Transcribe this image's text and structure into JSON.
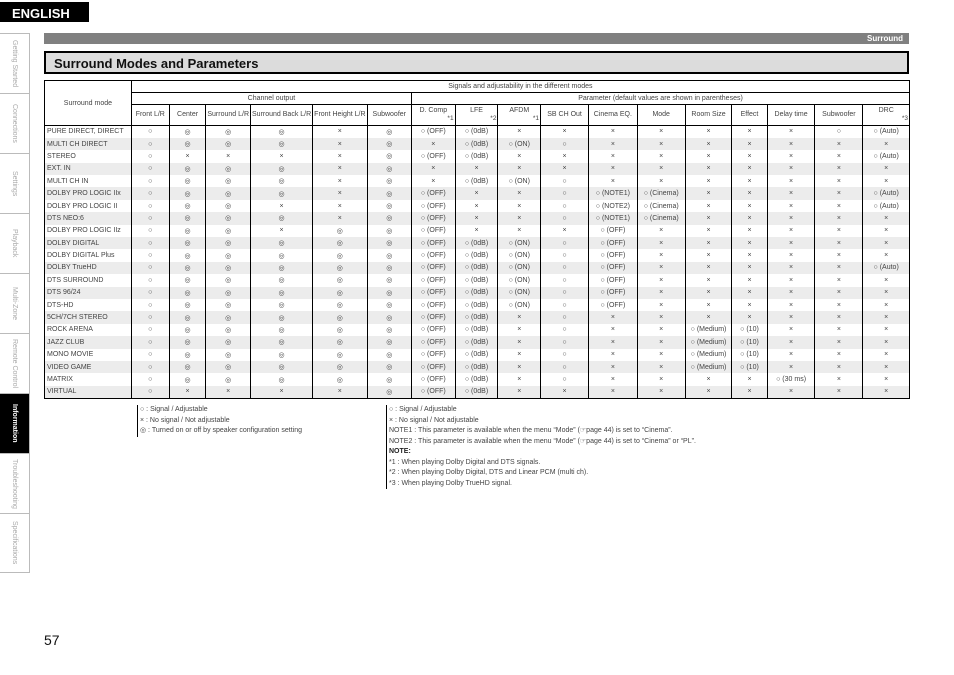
{
  "language": "ENGLISH",
  "side_nav": [
    {
      "label": "Getting Started",
      "active": false
    },
    {
      "label": "Connections",
      "active": false
    },
    {
      "label": "Settings",
      "active": false
    },
    {
      "label": "Playback",
      "active": false
    },
    {
      "label": "Multi-Zone",
      "active": false
    },
    {
      "label": "Remote Control",
      "active": false
    },
    {
      "label": "Information",
      "active": true
    },
    {
      "label": "Troubleshooting",
      "active": false
    },
    {
      "label": "Specifications",
      "active": false
    }
  ],
  "section_bar": "Surround",
  "page_title": "Surround Modes and Parameters",
  "table": {
    "mode_header": "Surround mode",
    "group_header": "Signals and adjustability in the different modes",
    "channel_header": "Channel output",
    "param_header": "Parameter (default values are shown in parentheses)",
    "columns": [
      {
        "label": "Front L/R",
        "note": ""
      },
      {
        "label": "Center",
        "note": ""
      },
      {
        "label": "Surround L/R",
        "note": ""
      },
      {
        "label": "Surround Back L/R",
        "note": ""
      },
      {
        "label": "Front Height L/R",
        "note": ""
      },
      {
        "label": "Subwoofer",
        "note": ""
      },
      {
        "label": "D. Comp",
        "note": "*1"
      },
      {
        "label": "LFE",
        "note": "*2"
      },
      {
        "label": "AFDM",
        "note": "*1"
      },
      {
        "label": "SB CH Out",
        "note": ""
      },
      {
        "label": "Cinema EQ.",
        "note": ""
      },
      {
        "label": "Mode",
        "note": ""
      },
      {
        "label": "Room Size",
        "note": ""
      },
      {
        "label": "Effect",
        "note": ""
      },
      {
        "label": "Delay time",
        "note": ""
      },
      {
        "label": "Subwoofer",
        "note": ""
      },
      {
        "label": "DRC",
        "note": "*3"
      }
    ],
    "rows": [
      {
        "mode": "PURE DIRECT, DIRECT",
        "cells": [
          "○",
          "◎",
          "◎",
          "◎",
          "×",
          "◎",
          "○ (OFF)",
          "○ (0dB)",
          "×",
          "×",
          "×",
          "×",
          "×",
          "×",
          "×",
          "○",
          "○ (Auto)"
        ]
      },
      {
        "mode": "MULTI CH DIRECT",
        "cells": [
          "○",
          "◎",
          "◎",
          "◎",
          "×",
          "◎",
          "×",
          "○ (0dB)",
          "○ (ON)",
          "○",
          "×",
          "×",
          "×",
          "×",
          "×",
          "×",
          "×"
        ]
      },
      {
        "mode": "STEREO",
        "cells": [
          "○",
          "×",
          "×",
          "×",
          "×",
          "◎",
          "○ (OFF)",
          "○ (0dB)",
          "×",
          "×",
          "×",
          "×",
          "×",
          "×",
          "×",
          "×",
          "○ (Auto)"
        ]
      },
      {
        "mode": "EXT. IN",
        "cells": [
          "○",
          "◎",
          "◎",
          "◎",
          "×",
          "◎",
          "×",
          "×",
          "×",
          "×",
          "×",
          "×",
          "×",
          "×",
          "×",
          "×",
          "×"
        ]
      },
      {
        "mode": "MULTI CH IN",
        "cells": [
          "○",
          "◎",
          "◎",
          "◎",
          "×",
          "◎",
          "×",
          "○ (0dB)",
          "○ (ON)",
          "○",
          "×",
          "×",
          "×",
          "×",
          "×",
          "×",
          "×"
        ]
      },
      {
        "mode": "DOLBY PRO LOGIC IIx",
        "cells": [
          "○",
          "◎",
          "◎",
          "◎",
          "×",
          "◎",
          "○ (OFF)",
          "×",
          "×",
          "○",
          "○ (NOTE1)",
          "○ (Cinema)",
          "×",
          "×",
          "×",
          "×",
          "○ (Auto)"
        ]
      },
      {
        "mode": "DOLBY PRO LOGIC II",
        "cells": [
          "○",
          "◎",
          "◎",
          "×",
          "×",
          "◎",
          "○ (OFF)",
          "×",
          "×",
          "○",
          "○ (NOTE2)",
          "○ (Cinema)",
          "×",
          "×",
          "×",
          "×",
          "○ (Auto)"
        ]
      },
      {
        "mode": "DTS NEO:6",
        "cells": [
          "○",
          "◎",
          "◎",
          "◎",
          "×",
          "◎",
          "○ (OFF)",
          "×",
          "×",
          "○",
          "○ (NOTE1)",
          "○ (Cinema)",
          "×",
          "×",
          "×",
          "×",
          "×"
        ]
      },
      {
        "mode": "DOLBY PRO LOGIC IIz",
        "cells": [
          "○",
          "◎",
          "◎",
          "×",
          "◎",
          "◎",
          "○ (OFF)",
          "×",
          "×",
          "×",
          "○ (OFF)",
          "×",
          "×",
          "×",
          "×",
          "×",
          "×"
        ]
      },
      {
        "mode": "DOLBY DIGITAL",
        "cells": [
          "○",
          "◎",
          "◎",
          "◎",
          "◎",
          "◎",
          "○ (OFF)",
          "○ (0dB)",
          "○ (ON)",
          "○",
          "○ (OFF)",
          "×",
          "×",
          "×",
          "×",
          "×",
          "×"
        ]
      },
      {
        "mode": "DOLBY DIGITAL Plus",
        "cells": [
          "○",
          "◎",
          "◎",
          "◎",
          "◎",
          "◎",
          "○ (OFF)",
          "○ (0dB)",
          "○ (ON)",
          "○",
          "○ (OFF)",
          "×",
          "×",
          "×",
          "×",
          "×",
          "×"
        ]
      },
      {
        "mode": "DOLBY TrueHD",
        "cells": [
          "○",
          "◎",
          "◎",
          "◎",
          "◎",
          "◎",
          "○ (OFF)",
          "○ (0dB)",
          "○ (ON)",
          "○",
          "○ (OFF)",
          "×",
          "×",
          "×",
          "×",
          "×",
          "○ (Auto)"
        ]
      },
      {
        "mode": "DTS SURROUND",
        "cells": [
          "○",
          "◎",
          "◎",
          "◎",
          "◎",
          "◎",
          "○ (OFF)",
          "○ (0dB)",
          "○ (ON)",
          "○",
          "○ (OFF)",
          "×",
          "×",
          "×",
          "×",
          "×",
          "×"
        ]
      },
      {
        "mode": "DTS 96/24",
        "cells": [
          "○",
          "◎",
          "◎",
          "◎",
          "◎",
          "◎",
          "○ (OFF)",
          "○ (0dB)",
          "○ (ON)",
          "○",
          "○ (OFF)",
          "×",
          "×",
          "×",
          "×",
          "×",
          "×"
        ]
      },
      {
        "mode": "DTS-HD",
        "cells": [
          "○",
          "◎",
          "◎",
          "◎",
          "◎",
          "◎",
          "○ (OFF)",
          "○ (0dB)",
          "○ (ON)",
          "○",
          "○ (OFF)",
          "×",
          "×",
          "×",
          "×",
          "×",
          "×"
        ]
      },
      {
        "mode": "5CH/7CH STEREO",
        "cells": [
          "○",
          "◎",
          "◎",
          "◎",
          "◎",
          "◎",
          "○ (OFF)",
          "○ (0dB)",
          "×",
          "○",
          "×",
          "×",
          "×",
          "×",
          "×",
          "×",
          "×"
        ]
      },
      {
        "mode": "ROCK ARENA",
        "cells": [
          "○",
          "◎",
          "◎",
          "◎",
          "◎",
          "◎",
          "○ (OFF)",
          "○ (0dB)",
          "×",
          "○",
          "×",
          "×",
          "○ (Medium)",
          "○ (10)",
          "×",
          "×",
          "×"
        ]
      },
      {
        "mode": "JAZZ CLUB",
        "cells": [
          "○",
          "◎",
          "◎",
          "◎",
          "◎",
          "◎",
          "○ (OFF)",
          "○ (0dB)",
          "×",
          "○",
          "×",
          "×",
          "○ (Medium)",
          "○ (10)",
          "×",
          "×",
          "×"
        ]
      },
      {
        "mode": "MONO MOVIE",
        "cells": [
          "○",
          "◎",
          "◎",
          "◎",
          "◎",
          "◎",
          "○ (OFF)",
          "○ (0dB)",
          "×",
          "○",
          "×",
          "×",
          "○ (Medium)",
          "○ (10)",
          "×",
          "×",
          "×"
        ]
      },
      {
        "mode": "VIDEO GAME",
        "cells": [
          "○",
          "◎",
          "◎",
          "◎",
          "◎",
          "◎",
          "○ (OFF)",
          "○ (0dB)",
          "×",
          "○",
          "×",
          "×",
          "○ (Medium)",
          "○ (10)",
          "×",
          "×",
          "×"
        ]
      },
      {
        "mode": "MATRIX",
        "cells": [
          "○",
          "◎",
          "◎",
          "◎",
          "◎",
          "◎",
          "○ (OFF)",
          "○ (0dB)",
          "×",
          "○",
          "×",
          "×",
          "×",
          "×",
          "○ (30 ms)",
          "×",
          "×"
        ]
      },
      {
        "mode": "VIRTUAL",
        "cells": [
          "○",
          "×",
          "×",
          "×",
          "×",
          "◎",
          "○ (OFF)",
          "○ (0dB)",
          "×",
          "×",
          "×",
          "×",
          "×",
          "×",
          "×",
          "×",
          "×"
        ]
      }
    ]
  },
  "legend_left": [
    "○ :  Signal / Adjustable",
    "× :  No signal / Not adjustable",
    "◎ :  Turned on or off by speaker configuration setting"
  ],
  "legend_right": [
    "○ :  Signal / Adjustable",
    "× :  No signal / Not adjustable",
    "NOTE1 : This parameter is available when the menu “Mode” (☞page 44) is set to “Cinema”.",
    "NOTE2 : This parameter is available when the menu “Mode” (☞page 44) is set to “Cinema” or “PL”."
  ],
  "notes_heading": "NOTE:",
  "notes": [
    "*1 :  When playing Dolby Digital and DTS signals.",
    "*2 :  When playing Dolby Digital, DTS and Linear PCM (multi ch).",
    "*3 :  When playing Dolby TrueHD signal."
  ],
  "page_number": "57"
}
